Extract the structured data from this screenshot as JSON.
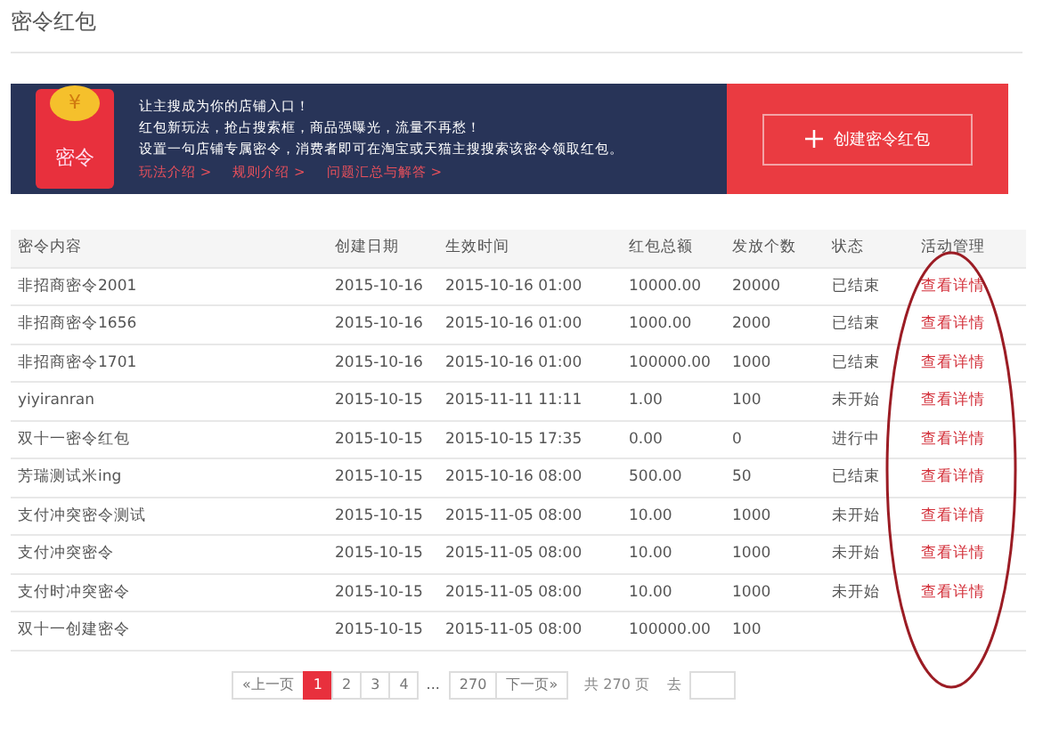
{
  "page_title": "密令红包",
  "banner": {
    "headline": "让主搜成为你的店铺入口！",
    "lines": [
      "红包新玩法，抢占搜索框，商品强曝光，流量不再愁！",
      "设置一句店铺专属密令，消费者即可在淘宝或天猫主搜搜索该密令领取红包。"
    ],
    "links": [
      "玩法介绍 >",
      "规则介绍 >",
      "问题汇总与解答 >"
    ],
    "badge_text": "密令",
    "coin_text": "¥",
    "create_button": "创建密令红包"
  },
  "table": {
    "columns": [
      "密令内容",
      "创建日期",
      "生效时间",
      "红包总额",
      "发放个数",
      "状态",
      "活动管理"
    ],
    "rows": [
      {
        "cells": [
          "非招商密令2001",
          "2015-10-16",
          "2015-10-16 01:00",
          "10000.00",
          "20000",
          "已结束"
        ],
        "action": "查看详情"
      },
      {
        "cells": [
          "非招商密令1656",
          "2015-10-16",
          "2015-10-16 01:00",
          "1000.00",
          "2000",
          "已结束"
        ],
        "action": "查看详情"
      },
      {
        "cells": [
          "非招商密令1701",
          "2015-10-16",
          "2015-10-16 01:00",
          "100000.00",
          "1000",
          "已结束"
        ],
        "action": "查看详情"
      },
      {
        "cells": [
          "yiyiranran",
          "2015-10-15",
          "2015-11-11 11:11",
          "1.00",
          "100",
          "未开始"
        ],
        "action": "查看详情"
      },
      {
        "cells": [
          "双十一密令红包",
          "2015-10-15",
          "2015-10-15 17:35",
          "0.00",
          "0",
          "进行中"
        ],
        "action": "查看详情"
      },
      {
        "cells": [
          "芳瑞测试米ing",
          "2015-10-15",
          "2015-10-16 08:00",
          "500.00",
          "50",
          "已结束"
        ],
        "action": "查看详情"
      },
      {
        "cells": [
          "支付冲突密令测试",
          "2015-10-15",
          "2015-11-05 08:00",
          "10.00",
          "1000",
          "未开始"
        ],
        "action": "查看详情"
      },
      {
        "cells": [
          "支付冲突密令",
          "2015-10-15",
          "2015-11-05 08:00",
          "10.00",
          "1000",
          "未开始"
        ],
        "action": "查看详情"
      },
      {
        "cells": [
          "支付时冲突密令",
          "2015-10-15",
          "2015-11-05 08:00",
          "10.00",
          "1000",
          "未开始"
        ],
        "action": "查看详情"
      },
      {
        "cells": [
          "双十一创建密令",
          "2015-10-15",
          "2015-11-05 08:00",
          "100000.00",
          "100"
        ]
      }
    ]
  },
  "pagination": {
    "prev": "«上一页",
    "pages": [
      {
        "label": "1",
        "selected": true
      },
      {
        "label": "2",
        "selected": false
      },
      {
        "label": "3",
        "selected": false
      },
      {
        "label": "4",
        "selected": false
      }
    ],
    "ellipsis": "...",
    "last": "270",
    "next": "下一页»",
    "total": "共 270 页",
    "goto": "去"
  }
}
